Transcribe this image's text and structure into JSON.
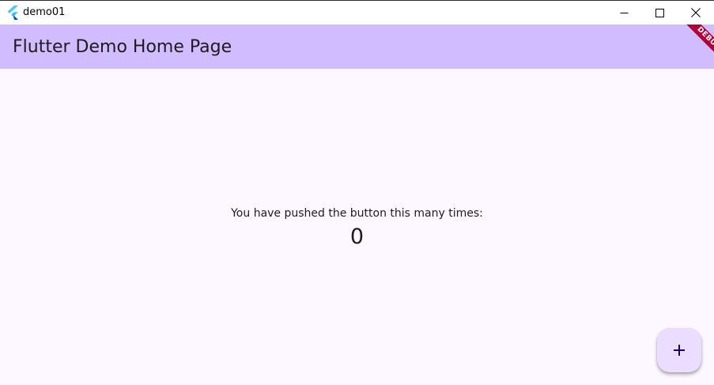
{
  "window": {
    "title": "demo01",
    "controls": {
      "minimize": "minimize-icon",
      "maximize": "maximize-icon",
      "close": "close-icon"
    }
  },
  "appbar": {
    "title": "Flutter Demo Home Page",
    "debug_banner": "DEBUG"
  },
  "main": {
    "message": "You have pushed the button this many times:",
    "counter": "0"
  },
  "fab": {
    "icon": "plus-icon"
  },
  "colors": {
    "appbar": "#d0bcfe",
    "background": "#fdf7ff",
    "fab": "#eaddff",
    "debug_banner": "#b0003a"
  }
}
